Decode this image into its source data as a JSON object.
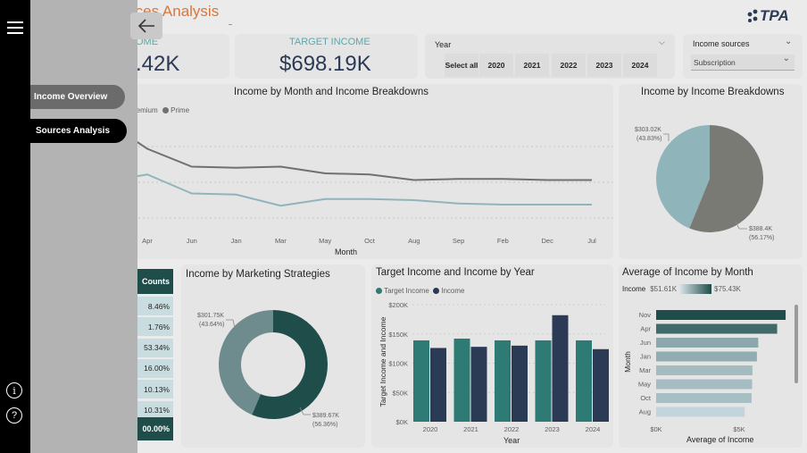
{
  "header": {
    "title": "Sources Analysis",
    "title_visible": "rces Analysis",
    "logo_text": "TPA"
  },
  "kpis": {
    "income_label_visible": "OME",
    "income_value_visible": ".42K",
    "target_label": "TARGET INCOME",
    "target_value": "$698.19K"
  },
  "year_slicer": {
    "label": "Year",
    "options": [
      "Select all",
      "2020",
      "2021",
      "2022",
      "2023",
      "2024"
    ]
  },
  "income_sources_slicer": {
    "label": "Income sources",
    "selected": "Subscription"
  },
  "line_card": {
    "title": "Income by Month and Income Breakdowns",
    "legend": [
      "Premium",
      "Prime"
    ],
    "legend_visible": [
      "remium",
      "Prime"
    ],
    "xlabel": "Month"
  },
  "pie_card": {
    "title": "Income by Income Breakdowns"
  },
  "counts_card": {
    "header_visible": "Counts",
    "total_visible": "00.00%"
  },
  "donut_card": {
    "title": "Income by Marketing Strategies"
  },
  "bar_card": {
    "title": "Target Income and Income by Year",
    "legend": [
      "Target Income",
      "Income"
    ],
    "ylabel": "Target Income and Income",
    "xlabel": "Year"
  },
  "hbar_card": {
    "title": "Average of Income by Month",
    "legend_label": "Income",
    "legend_min": "$51.61K",
    "legend_max": "$75.43K",
    "ylabel": "Month",
    "xlabel": "Average of Income"
  },
  "nav": {
    "items": [
      "Income Overview",
      "Sources Analysis"
    ],
    "active_index": 1,
    "menu_icon": "hamburger-icon",
    "back_icon": "back-arrow-icon",
    "info_icon": "info-icon",
    "help_icon": "help-icon"
  },
  "colors": {
    "accent_orange": "#d9773a",
    "dark_teal": "#1e4d4a",
    "teal": "#2e7b76",
    "navy": "#2b3a55",
    "light_teal": "#8fb5bb",
    "gray_line": "#707070"
  },
  "chart_data": [
    {
      "type": "line",
      "title": "Income by Month and Income Breakdowns",
      "xlabel": "Month",
      "categories": [
        "Apr",
        "Jun",
        "Jan",
        "Mar",
        "May",
        "Oct",
        "Aug",
        "Sep",
        "Feb",
        "Dec",
        "Jul"
      ],
      "series": [
        {
          "name": "Premium",
          "color": "#707070",
          "values": [
            0.78,
            0.62,
            0.61,
            0.62,
            0.56,
            0.55,
            0.5,
            0.51,
            0.51,
            0.5,
            0.5
          ]
        },
        {
          "name": "Prime",
          "color": "#8fb5bb",
          "values": [
            0.55,
            0.38,
            0.37,
            0.27,
            0.33,
            0.33,
            0.32,
            0.29,
            0.28,
            0.28,
            0.28
          ]
        }
      ],
      "grid": true
    },
    {
      "type": "pie",
      "title": "Income by Income Breakdowns",
      "slices": [
        {
          "value": 303.02,
          "label": "$303.02K",
          "pct": "(43.83%)",
          "color": "#8fb5bb"
        },
        {
          "value": 388.4,
          "label": "$388.4K",
          "pct": "(56.17%)",
          "color": "#7a7a75"
        }
      ]
    },
    {
      "type": "table",
      "title": "Counts",
      "values": [
        "8.46%",
        "1.76%",
        "53.34%",
        "16.00%",
        "10.13%",
        "10.31%"
      ]
    },
    {
      "type": "pie",
      "subtype": "donut",
      "title": "Income by Marketing Strategies",
      "slices": [
        {
          "value": 301.75,
          "label": "$301.75K",
          "pct": "(43.64%)",
          "color": "#6e8c8e"
        },
        {
          "value": 389.67,
          "label": "$389.67K",
          "pct": "(56.36%)",
          "color": "#1e4d4a"
        }
      ]
    },
    {
      "type": "bar",
      "title": "Target Income and Income by Year",
      "xlabel": "Year",
      "ylabel": "Target Income and Income",
      "categories": [
        "2020",
        "2021",
        "2022",
        "2023",
        "2024"
      ],
      "ylim": [
        0,
        200
      ],
      "yticks": [
        "$0K",
        "$50K",
        "$100K",
        "$150K",
        "$200K"
      ],
      "series": [
        {
          "name": "Target Income",
          "color": "#2e7b76",
          "values": [
            139,
            142,
            139,
            139,
            139
          ]
        },
        {
          "name": "Income",
          "color": "#2b3a55",
          "values": [
            126,
            128,
            130,
            182,
            124
          ]
        }
      ]
    },
    {
      "type": "bar",
      "orientation": "horizontal",
      "title": "Average of Income by Month",
      "xlabel": "Average of Income",
      "ylabel": "Month",
      "categories": [
        "Nov",
        "Apr",
        "Jun",
        "Jan",
        "Mar",
        "May",
        "Oct",
        "Aug"
      ],
      "values": [
        75.43,
        70.5,
        59.5,
        58.7,
        56.1,
        55.9,
        55.6,
        51.61
      ],
      "xticks": [
        "$0K",
        "$5K"
      ],
      "xlim": [
        0,
        78
      ]
    }
  ]
}
